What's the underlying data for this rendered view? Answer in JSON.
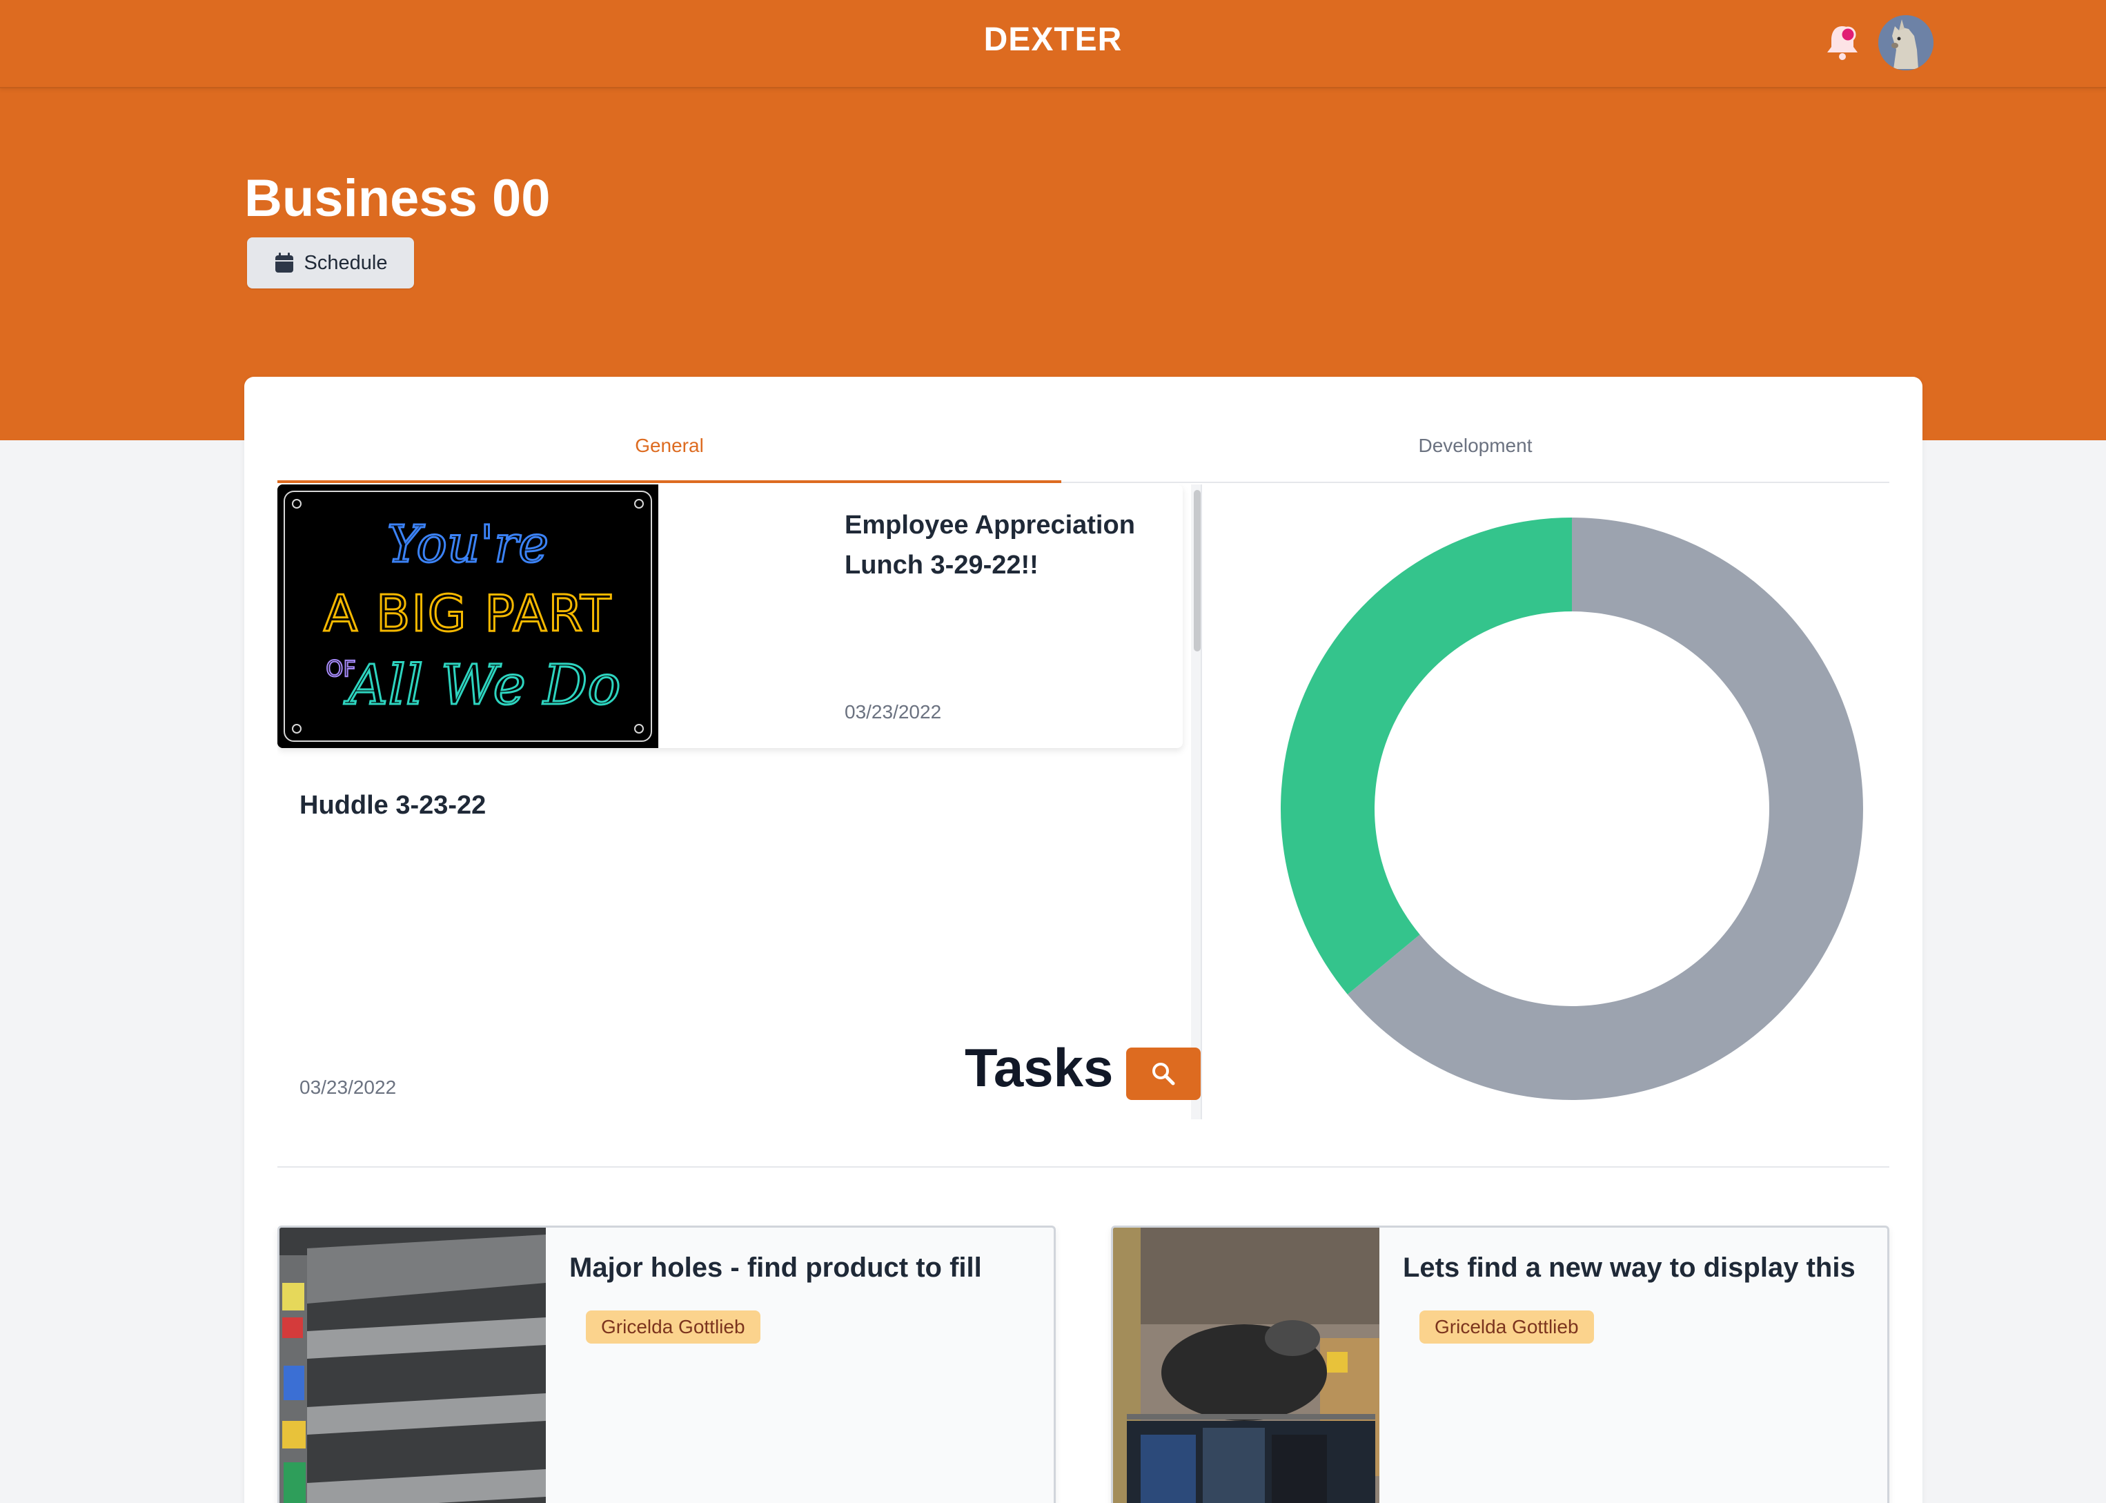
{
  "app": {
    "brand": "DEXTER"
  },
  "header": {
    "notification_icon": "bell-icon",
    "avatar_icon": "llama-avatar"
  },
  "page": {
    "title": "Business 00",
    "schedule_label": "Schedule"
  },
  "tabs": [
    {
      "label": "General",
      "active": true
    },
    {
      "label": "Development",
      "active": false
    }
  ],
  "feed": {
    "posts": [
      {
        "title": "Employee Appreciation Lunch 3-29-22!!",
        "date": "03/23/2022",
        "image_text": [
          "You're",
          "A BIG PART",
          "OF",
          "All We Do"
        ]
      },
      {
        "title": "Huddle 3-23-22",
        "date": "03/23/2022"
      }
    ]
  },
  "donut": {
    "fractions": [
      0.36,
      0.64
    ],
    "colors": [
      "#34c48c",
      "#9ca3af"
    ]
  },
  "tasks": {
    "title": "Tasks",
    "search_icon": "search-icon",
    "items": [
      {
        "title": "Major holes - find product to fill",
        "assignee": "Gricelda Gottlieb"
      },
      {
        "title": "Lets find a new way to display this",
        "assignee": "Gricelda Gottlieb"
      }
    ]
  },
  "colors": {
    "brand_orange": "#dd6b20",
    "badge_bg": "#fbd38d"
  }
}
